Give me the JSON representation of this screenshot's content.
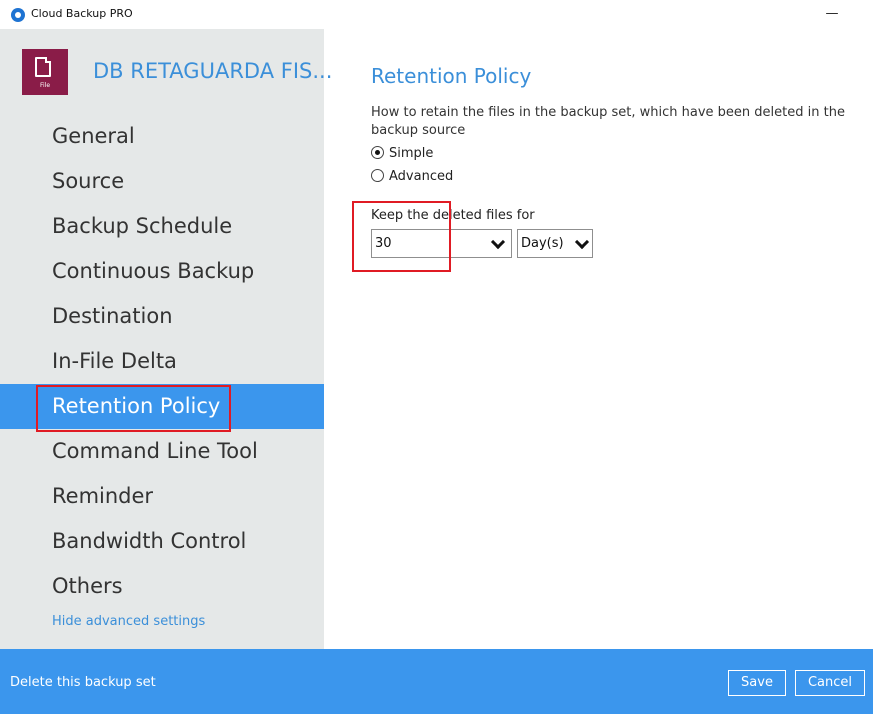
{
  "window": {
    "title": "Cloud Backup PRO",
    "minimize_label": "—"
  },
  "sidebar": {
    "backup_set_name": "DB RETAGUARDA FIS...",
    "backup_set_icon_label": "File",
    "items": [
      {
        "label": "General"
      },
      {
        "label": "Source"
      },
      {
        "label": "Backup Schedule"
      },
      {
        "label": "Continuous Backup"
      },
      {
        "label": "Destination"
      },
      {
        "label": "In-File Delta"
      },
      {
        "label": "Retention Policy",
        "active": true
      },
      {
        "label": "Command Line Tool"
      },
      {
        "label": "Reminder"
      },
      {
        "label": "Bandwidth Control"
      },
      {
        "label": "Others"
      }
    ],
    "hide_advanced": "Hide advanced settings"
  },
  "main": {
    "title": "Retention Policy",
    "description": "How to retain the files in the backup set, which have been deleted in the backup source",
    "options": [
      {
        "label": "Simple",
        "selected": true
      },
      {
        "label": "Advanced",
        "selected": false
      }
    ],
    "keep_label": "Keep the deleted files for",
    "keep_value": "30",
    "unit_value": "Day(s)"
  },
  "footer": {
    "delete_label": "Delete this backup set",
    "save_label": "Save",
    "cancel_label": "Cancel"
  },
  "colors": {
    "accent": "#3b96ed",
    "link": "#3b8fd9",
    "sidebar_bg": "#e5e8e8",
    "icon_bg": "#8a1c48",
    "annotation": "#e01b24"
  }
}
